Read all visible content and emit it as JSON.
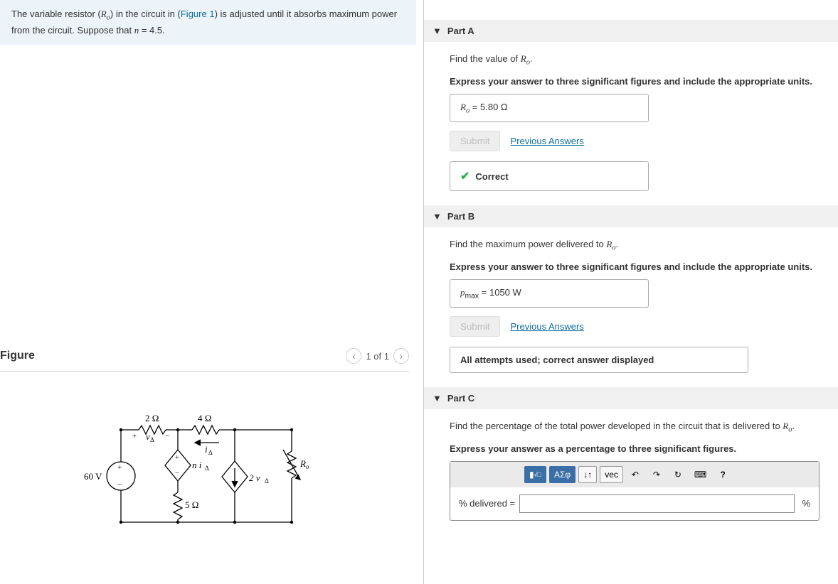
{
  "problem": {
    "text_pre": "The variable resistor (",
    "var1_html": "R",
    "var1_sub": "o",
    "text_mid1": ") in the circuit in (",
    "figure_link": "Figure 1",
    "text_mid2": ") is adjusted until it absorbs maximum power from the circuit. Suppose that ",
    "var2": "n",
    "text_end": " = 4.5."
  },
  "figure": {
    "title": "Figure",
    "pager": "1 of 1",
    "labels": {
      "R2": "2 Ω",
      "R4": "4 Ω",
      "R5": "5 Ω",
      "V60": "60 V",
      "vdelta_plus": "+",
      "vdelta": "v",
      "vdelta_sub": "Δ",
      "vdelta_minus": "−",
      "idelta": "i",
      "idelta_sub": "Δ",
      "ni": "n i",
      "ni_sub": "Δ",
      "twov": "2 v",
      "twov_sub": "Δ",
      "Ro": "R",
      "Ro_sub": "o"
    }
  },
  "parts": [
    {
      "id": "A",
      "title": "Part A",
      "question_pre": "Find the value of ",
      "question_var": "R",
      "question_sub": "o",
      "question_post": ".",
      "subinstr": "Express your answer to three significant figures and include the appropriate units.",
      "ans_label": "R",
      "ans_sub": "o",
      "ans_eq": "=",
      "ans_val": "5.80 Ω",
      "submit": "Submit",
      "prev": "Previous Answers",
      "status": "Correct",
      "status_type": "correct"
    },
    {
      "id": "B",
      "title": "Part B",
      "question_pre": "Find the maximum power delivered to ",
      "question_var": "R",
      "question_sub": "o",
      "question_post": ".",
      "subinstr": "Express your answer to three significant figures and include the appropriate units.",
      "ans_label": "p",
      "ans_sub": "max",
      "ans_eq": "=",
      "ans_val": "1050 W",
      "submit": "Submit",
      "prev": "Previous Answers",
      "status": "All attempts used; correct answer displayed",
      "status_type": "info"
    },
    {
      "id": "C",
      "title": "Part C",
      "question_pre": "Find the percentage of the total power developed in the circuit that is delivered to ",
      "question_var": "R",
      "question_sub": "o",
      "question_post": ".",
      "subinstr": "Express your answer as a percentage to three significant figures.",
      "composer_label": "% delivered =",
      "unit": "%",
      "toolbar": {
        "templates": "x□",
        "greek": "ΑΣφ",
        "subsup": "↓↑",
        "vec": "vec",
        "undo": "↶",
        "redo": "↷",
        "reset": "↻",
        "keyboard": "⌨",
        "help": "?"
      }
    }
  ]
}
